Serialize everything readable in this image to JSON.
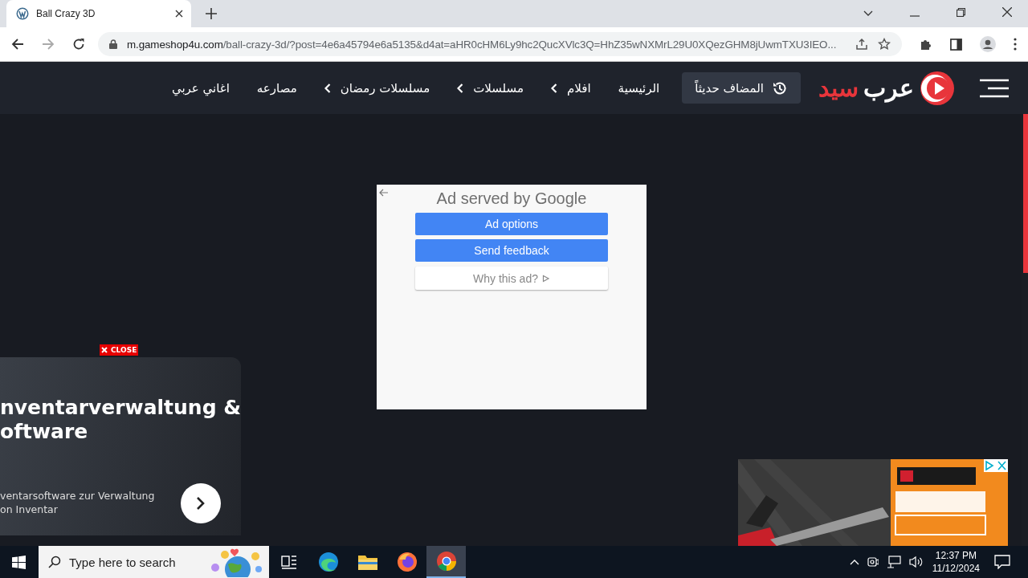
{
  "browser": {
    "tabs": [
      {
        "title": "Ball Crazy 3D",
        "selected": true
      }
    ],
    "address": {
      "host": "m.gameshop4u.com",
      "path": "/ball-crazy-3d/?post=4e6a45794e6a5135&d4at=aHR0cHM6Ly9hc2QucXVlc3Q=HhZ35wNXMrL29U0XQezGHM8jUwmTXU3IEO..."
    }
  },
  "site_header": {
    "logo": [
      {
        "text": "عرب",
        "color": "#ffffff"
      },
      {
        "text": "سيد",
        "color": "#e8353b"
      }
    ],
    "recent_button": "المضاف حديثاً",
    "nav": [
      {
        "label": "الرئيسية",
        "has_submenu": false
      },
      {
        "label": "افلام",
        "has_submenu": true
      },
      {
        "label": "مسلسلات",
        "has_submenu": true
      },
      {
        "label": "مسلسلات رمضان",
        "has_submenu": true
      },
      {
        "label": "مصارعه",
        "has_submenu": false
      },
      {
        "label": "اغاني عربي",
        "has_submenu": false
      }
    ]
  },
  "google_ad": {
    "title": "Ad served by Google",
    "buttons": [
      {
        "label": "Ad options",
        "kind": "primary"
      },
      {
        "label": "Send feedback",
        "kind": "primary"
      },
      {
        "label": "Why this ad?",
        "kind": "secondary"
      }
    ]
  },
  "side_ad": {
    "close": "CLOSE",
    "title_lines": [
      "nventarverwaltung &",
      "oftware"
    ],
    "text_lines": [
      "ventarsoftware zur Verwaltung",
      "on Inventar"
    ]
  },
  "taskbar": {
    "search": {
      "placeholder": "Type here to search"
    },
    "apps": [
      {
        "kind": "taskview",
        "selected": false
      },
      {
        "kind": "edge",
        "selected": false
      },
      {
        "kind": "files",
        "selected": false
      },
      {
        "kind": "firefox",
        "selected": false
      },
      {
        "kind": "chrome",
        "selected": true
      }
    ],
    "time": "12:37 PM",
    "date": "11/12/2024"
  }
}
